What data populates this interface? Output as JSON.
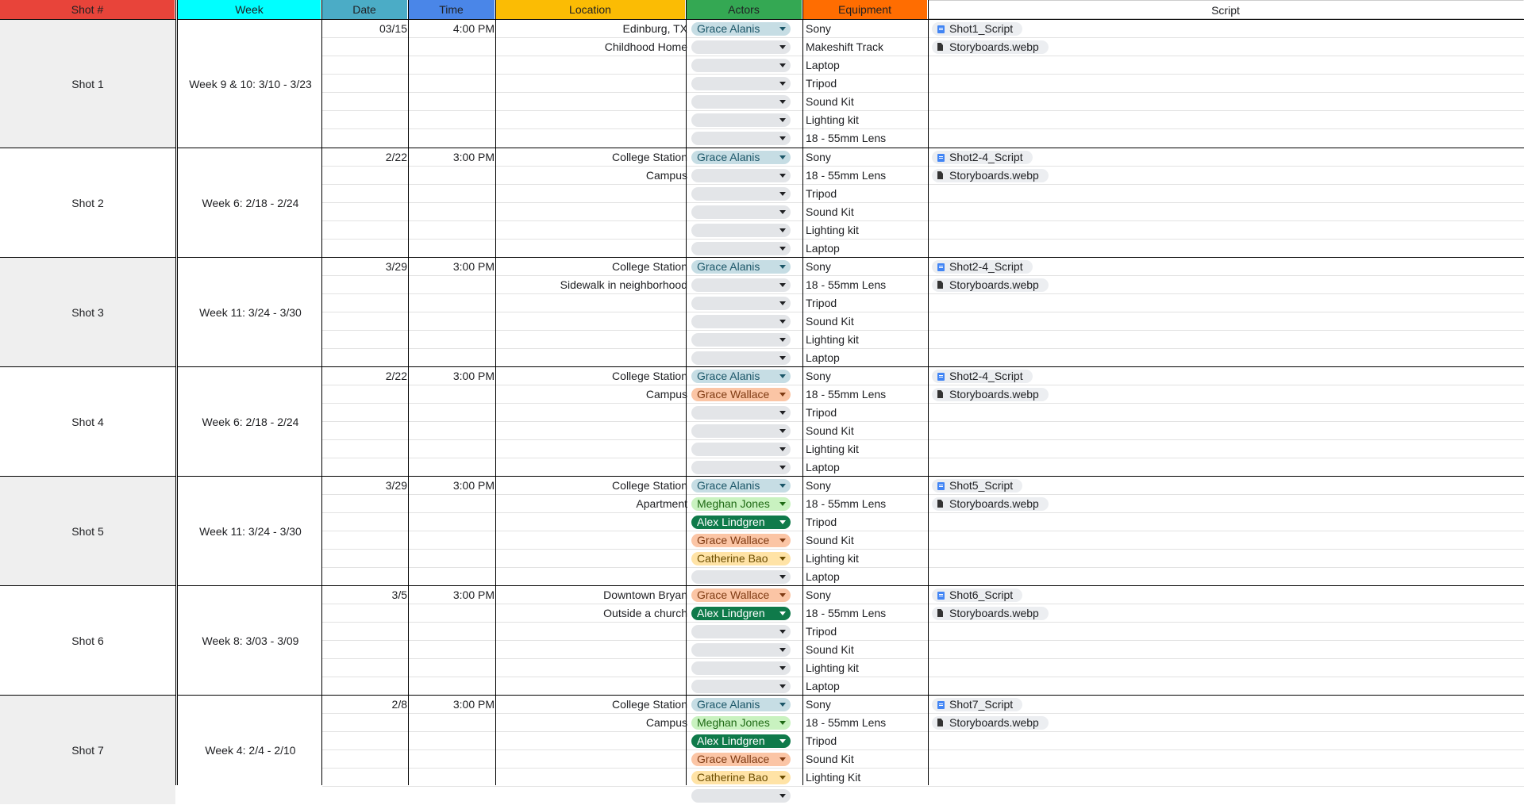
{
  "headers": {
    "shot": "Shot #",
    "week": "Week",
    "date": "Date",
    "time": "Time",
    "location": "Location",
    "actors": "Actors",
    "equipment": "Equipment",
    "script": "Script"
  },
  "header_colors": {
    "shot": "#e8443a",
    "week": "#00ffff",
    "date": "#4bacc6",
    "time": "#4a86e8",
    "location": "#fbbc04",
    "actors": "#34a853",
    "equipment": "#ff6d01",
    "script": "#ffffff"
  },
  "actor_colors": {
    "Grace Alanis": "#c6dde4",
    "Grace Wallace": "#fbc5a5",
    "Meghan Jones": "#c9f2c0",
    "Alex Lindgren": "#0f7a4a",
    "Catherine Bao": "#ffe3a6"
  },
  "shots": [
    {
      "shot": "Shot 1",
      "week": "Week 9 & 10: 3/10 - 3/23",
      "date": "03/15",
      "time": "4:00 PM",
      "location": [
        "Edinburg, TX",
        "Childhood Home"
      ],
      "actors": [
        "Grace Alanis",
        "",
        "",
        "",
        "",
        "",
        ""
      ],
      "equipment": [
        "Sony",
        "Makeshift Track",
        "Laptop",
        "Tripod",
        "Sound Kit",
        "Lighting kit",
        "18 - 55mm Lens"
      ],
      "script": [
        {
          "icon": "doc-icon",
          "label": "Shot1_Script"
        },
        {
          "icon": "file-icon",
          "label": "Storyboards.webp"
        }
      ],
      "gray": true
    },
    {
      "shot": "Shot 2",
      "week": "Week 6: 2/18 - 2/24",
      "date": "2/22",
      "time": "3:00 PM",
      "location": [
        "College Station",
        "Campus"
      ],
      "actors": [
        "Grace Alanis",
        "",
        "",
        "",
        "",
        ""
      ],
      "equipment": [
        "Sony",
        "18 - 55mm Lens",
        "Tripod",
        "Sound Kit",
        "Lighting kit",
        "Laptop"
      ],
      "script": [
        {
          "icon": "doc-icon",
          "label": "Shot2-4_Script"
        },
        {
          "icon": "file-icon",
          "label": "Storyboards.webp"
        }
      ],
      "gray": false
    },
    {
      "shot": "Shot 3",
      "week": "Week 11: 3/24 - 3/30",
      "date": "3/29",
      "time": "3:00 PM",
      "location": [
        "College Station",
        "Sidewalk in neighborhood"
      ],
      "actors": [
        "Grace Alanis",
        "",
        "",
        "",
        "",
        ""
      ],
      "equipment": [
        "Sony",
        "18 - 55mm Lens",
        "Tripod",
        "Sound Kit",
        "Lighting kit",
        "Laptop"
      ],
      "script": [
        {
          "icon": "doc-icon",
          "label": "Shot2-4_Script"
        },
        {
          "icon": "file-icon",
          "label": "Storyboards.webp"
        }
      ],
      "gray": true
    },
    {
      "shot": "Shot 4",
      "week": "Week 6: 2/18 - 2/24",
      "date": "2/22",
      "time": "3:00 PM",
      "location": [
        "College Station",
        "Campus"
      ],
      "actors": [
        "Grace Alanis",
        "Grace Wallace",
        "",
        "",
        "",
        ""
      ],
      "equipment": [
        "Sony",
        "18 - 55mm Lens",
        "Tripod",
        "Sound Kit",
        "Lighting kit",
        "Laptop"
      ],
      "script": [
        {
          "icon": "doc-icon",
          "label": "Shot2-4_Script"
        },
        {
          "icon": "file-icon",
          "label": "Storyboards.webp"
        }
      ],
      "gray": false
    },
    {
      "shot": "Shot 5",
      "week": "Week 11: 3/24 - 3/30",
      "date": "3/29",
      "time": "3:00 PM",
      "location": [
        "College Station",
        "Apartment"
      ],
      "actors": [
        "Grace Alanis",
        "Meghan Jones",
        "Alex Lindgren",
        "Grace Wallace",
        "Catherine Bao",
        ""
      ],
      "equipment": [
        "Sony",
        "18 - 55mm Lens",
        "Tripod",
        "Sound Kit",
        "Lighting kit",
        "Laptop"
      ],
      "script": [
        {
          "icon": "doc-icon",
          "label": "Shot5_Script"
        },
        {
          "icon": "file-icon",
          "label": "Storyboards.webp"
        }
      ],
      "gray": true
    },
    {
      "shot": "Shot 6",
      "week": "Week 8: 3/03 - 3/09",
      "date": "3/5",
      "time": "3:00 PM",
      "location": [
        "Downtown Bryan",
        "Outside a church"
      ],
      "actors": [
        "Grace Wallace",
        "Alex Lindgren",
        "",
        "",
        "",
        ""
      ],
      "equipment": [
        "Sony",
        "18 - 55mm Lens",
        "Tripod",
        "Sound Kit",
        "Lighting kit",
        "Laptop"
      ],
      "script": [
        {
          "icon": "doc-icon",
          "label": "Shot6_Script"
        },
        {
          "icon": "file-icon",
          "label": "Storyboards.webp"
        }
      ],
      "gray": false
    },
    {
      "shot": "Shot 7",
      "week": "Week 4: 2/4 - 2/10",
      "date": "2/8",
      "time": "3:00 PM",
      "location": [
        "College Station",
        "Campus"
      ],
      "actors": [
        "Grace Alanis",
        "Meghan Jones",
        "Alex Lindgren",
        "Grace Wallace",
        "Catherine Bao",
        ""
      ],
      "equipment": [
        "Sony",
        "18 - 55mm Lens",
        "Tripod",
        "Sound Kit",
        "Lighting Kit",
        ""
      ],
      "script": [
        {
          "icon": "doc-icon",
          "label": "Shot7_Script"
        },
        {
          "icon": "file-icon",
          "label": "Storyboards.webp"
        }
      ],
      "gray": true
    }
  ]
}
